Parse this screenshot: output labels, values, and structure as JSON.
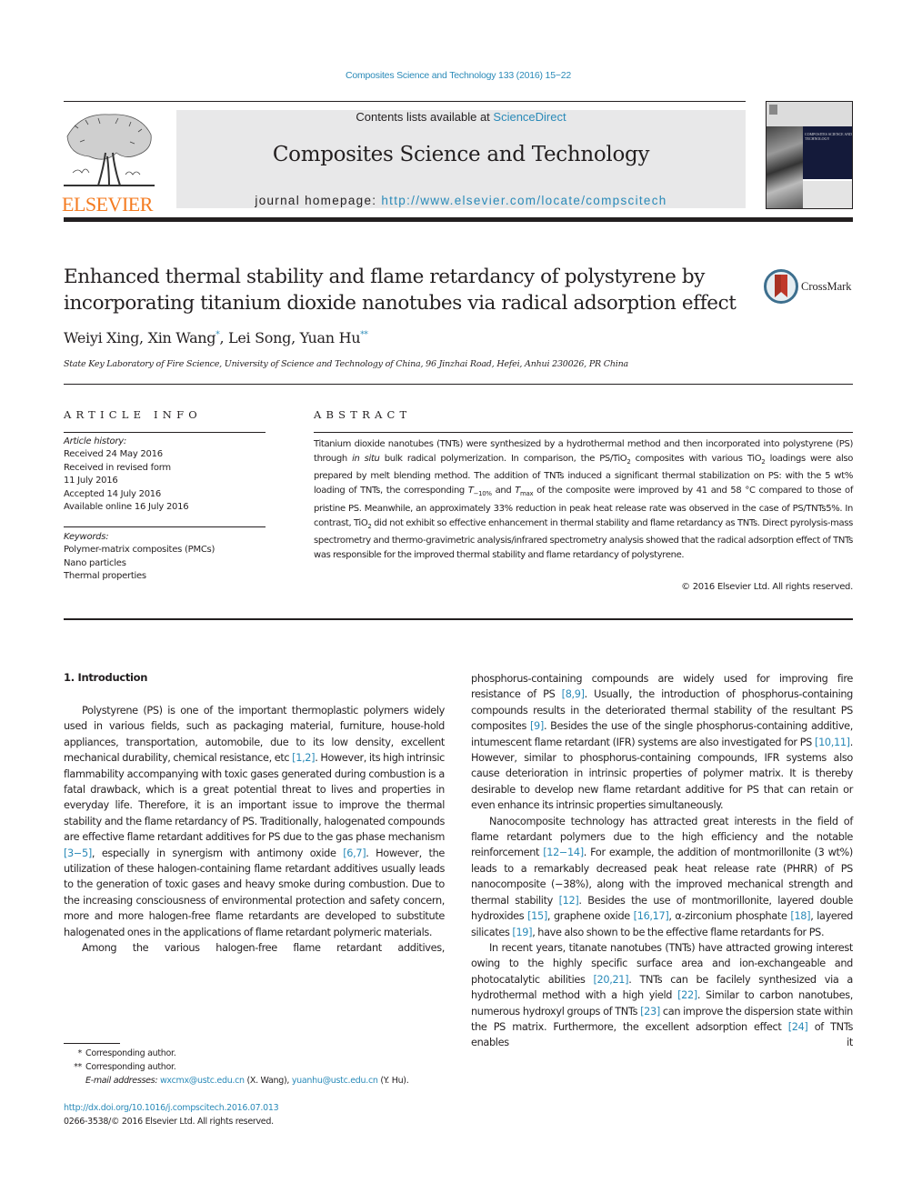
{
  "header": {
    "citation": "Composites Science and Technology 133 (2016) 15−22",
    "publisher_logo_text": "ELSEVIER",
    "contents_prefix": "Contents lists available at ",
    "contents_link": "ScienceDirect",
    "journal_name": "Composites Science and Technology",
    "homepage_prefix": "journal homepage: ",
    "homepage_url": "http://www.elsevier.com/locate/compscitech",
    "cover_title": "COMPOSITES SCIENCE AND TECHNOLOGY"
  },
  "article": {
    "title_line1": "Enhanced thermal stability and flame retardancy of polystyrene by",
    "title_line2": "incorporating titanium dioxide nanotubes via radical adsorption effect",
    "crossmark_label": "CrossMark",
    "authors": [
      {
        "name": "Weiyi Xing",
        "sep": ", "
      },
      {
        "name": "Xin Wang",
        "mark": "*",
        "sep": ", "
      },
      {
        "name": "Lei Song",
        "sep": ", "
      },
      {
        "name": "Yuan Hu",
        "mark": "**",
        "sep": ""
      }
    ],
    "affiliation": "State Key Laboratory of Fire Science, University of Science and Technology of China, 96 Jinzhai Road, Hefei, Anhui 230026, PR China"
  },
  "article_info": {
    "heading": "ARTICLE INFO",
    "history_label": "Article history:",
    "history": [
      "Received 24 May 2016",
      "Received in revised form",
      "11 July 2016",
      "Accepted 14 July 2016",
      "Available online 16 July 2016"
    ],
    "keywords_label": "Keywords:",
    "keywords": [
      "Polymer-matrix composites (PMCs)",
      "Nano particles",
      "Thermal properties"
    ]
  },
  "abstract": {
    "heading": "ABSTRACT",
    "p1": "Titanium dioxide nanotubes (TNTs) were synthesized by a hydrothermal method and then incorporated into polystyrene (PS) through ",
    "p1_italic": "in situ",
    "p2": " bulk radical polymerization. In comparison, the PS/TiO",
    "p3": " composites with various TiO",
    "p4": " loadings were also prepared by melt blending method. The addition of TNTs induced a significant thermal stabilization on PS: with the 5 wt% loading of TNTs, the corresponding ",
    "t_sym": "T",
    "t10_sub": "−10%",
    "and": " and ",
    "tmax_sub": "max",
    "p5": " of the composite were improved by 41 and 58 °C compared to those of pristine PS. Meanwhile, an approximately 33% reduction in peak heat release rate was observed in the case of PS/TNTs5%. In contrast, TiO",
    "p6": " did not exhibit so effective enhancement in thermal stability and flame retardancy as TNTs. Direct pyrolysis-mass spectrometry and thermo-gravimetric analysis/infrared spectrometry analysis showed that the radical adsorption effect of TNTs was responsible for the improved thermal stability and flame retardancy of polystyrene.",
    "sub2": "2",
    "copyright": "© 2016 Elsevier Ltd. All rights reserved."
  },
  "introduction": {
    "heading": "1.  Introduction",
    "left": [
      {
        "t": "Polystyrene (PS) is one of the important thermoplastic polymers widely used in various fields, such as packaging material, furniture, house-hold appliances, transportation, automobile, due to its low density, excellent mechanical durability, chemical resistance, etc "
      },
      {
        "ref": "[1,2]"
      },
      {
        "t": ". However, its high intrinsic flammability accompanying with toxic gases generated during combustion is a fatal drawback, which is a great potential threat to lives and properties in everyday life. Therefore, it is an important issue to improve the thermal stability and the flame retardancy of PS. Traditionally, halogenated compounds are effective flame retardant additives for PS due to the gas phase mechanism "
      },
      {
        "ref": "[3−5]"
      },
      {
        "t": ", especially in synergism with antimony oxide "
      },
      {
        "ref": "[6,7]"
      },
      {
        "t": ". However, the utilization of these halogen-containing flame retardant additives usually leads to the generation of toxic gases and heavy smoke during combustion. Due to the increasing consciousness of environmental protection and safety concern, more and more halogen-free flame retardants are developed to substitute halogenated ones in the applications of flame retardant polymeric materials."
      }
    ],
    "left_p2": "Among the various halogen-free flame retardant additives,",
    "right_p1": [
      {
        "t": "phosphorus-containing compounds are widely used for improving fire resistance of PS "
      },
      {
        "ref": "[8,9]"
      },
      {
        "t": ". Usually, the introduction of phosphorus-containing compounds results in the deteriorated thermal stability of the resultant PS composites "
      },
      {
        "ref": "[9]"
      },
      {
        "t": ". Besides the use of the single phosphorus-containing additive, intumescent flame retardant (IFR) systems are also investigated for PS "
      },
      {
        "ref": "[10,11]"
      },
      {
        "t": ". However, similar to phosphorus-containing compounds, IFR systems also cause deterioration in intrinsic properties of polymer matrix. It is thereby desirable to develop new flame retardant additive for PS that can retain or even enhance its intrinsic properties simultaneously."
      }
    ],
    "right_p2": [
      {
        "t": "Nanocomposite technology has attracted great interests in the field of flame retardant polymers due to the high efficiency and the notable reinforcement "
      },
      {
        "ref": "[12−14]"
      },
      {
        "t": ". For example, the addition of montmorillonite (3 wt%) leads to a remarkably decreased peak heat release rate (PHRR) of PS nanocomposite (−38%), along with the improved mechanical strength and thermal stability "
      },
      {
        "ref": "[12]"
      },
      {
        "t": ". Besides the use of montmorillonite, layered double hydroxides "
      },
      {
        "ref": "[15]"
      },
      {
        "t": ", graphene oxide "
      },
      {
        "ref": "[16,17]"
      },
      {
        "t": ", α-zirconium phosphate "
      },
      {
        "ref": "[18]"
      },
      {
        "t": ", layered silicates "
      },
      {
        "ref": "[19]"
      },
      {
        "t": ", have also shown to be the effective flame retardants for PS."
      }
    ],
    "right_p3": [
      {
        "t": "In recent years, titanate nanotubes (TNTs) have attracted growing interest owing to the highly specific surface area and ion-exchangeable and photocatalytic abilities "
      },
      {
        "ref": "[20,21]"
      },
      {
        "t": ". TNTs can be facilely synthesized via a hydrothermal method with a high yield "
      },
      {
        "ref": "[22]"
      },
      {
        "t": ". Similar to carbon nanotubes, numerous hydroxyl groups of TNTs "
      },
      {
        "ref": "[23]"
      },
      {
        "t": " can improve the dispersion state within the PS matrix. Furthermore, the excellent adsorption effect "
      },
      {
        "ref": "[24]"
      },
      {
        "t": " of TNTs enables it"
      }
    ]
  },
  "footnotes": {
    "fn1_mark": "*",
    "fn1_text": "Corresponding author.",
    "fn2_mark": "**",
    "fn2_text": "Corresponding author.",
    "email_label": "E-mail addresses: ",
    "email1": "wxcmx@ustc.edu.cn",
    "email1_owner": " (X. Wang), ",
    "email2": "yuanhu@ustc.edu.cn",
    "email2_owner": " (Y. Hu).",
    "doi": "http://dx.doi.org/10.1016/j.compscitech.2016.07.013",
    "issn": "0266-3538/© 2016 Elsevier Ltd. All rights reserved."
  },
  "colors": {
    "link": "#2a8ab8",
    "elsevier_orange": "#f47b20",
    "banner_gray": "#e8e8e9",
    "text": "#231f20"
  }
}
